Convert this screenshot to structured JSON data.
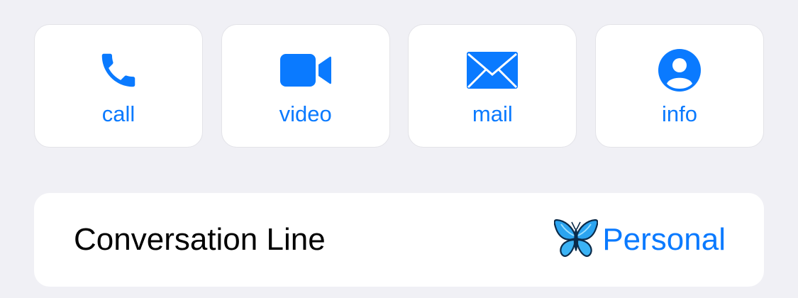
{
  "actions": [
    {
      "label": "call",
      "icon": "phone-icon"
    },
    {
      "label": "video",
      "icon": "video-camera-icon"
    },
    {
      "label": "mail",
      "icon": "envelope-icon"
    },
    {
      "label": "info",
      "icon": "person-circle-icon"
    }
  ],
  "conversation_line": {
    "label": "Conversation Line",
    "value": "Personal",
    "icon": "butterfly-icon"
  },
  "colors": {
    "accent": "#0A7AFF",
    "background": "#F0F0F5",
    "card": "#FFFFFF",
    "text": "#000000"
  }
}
